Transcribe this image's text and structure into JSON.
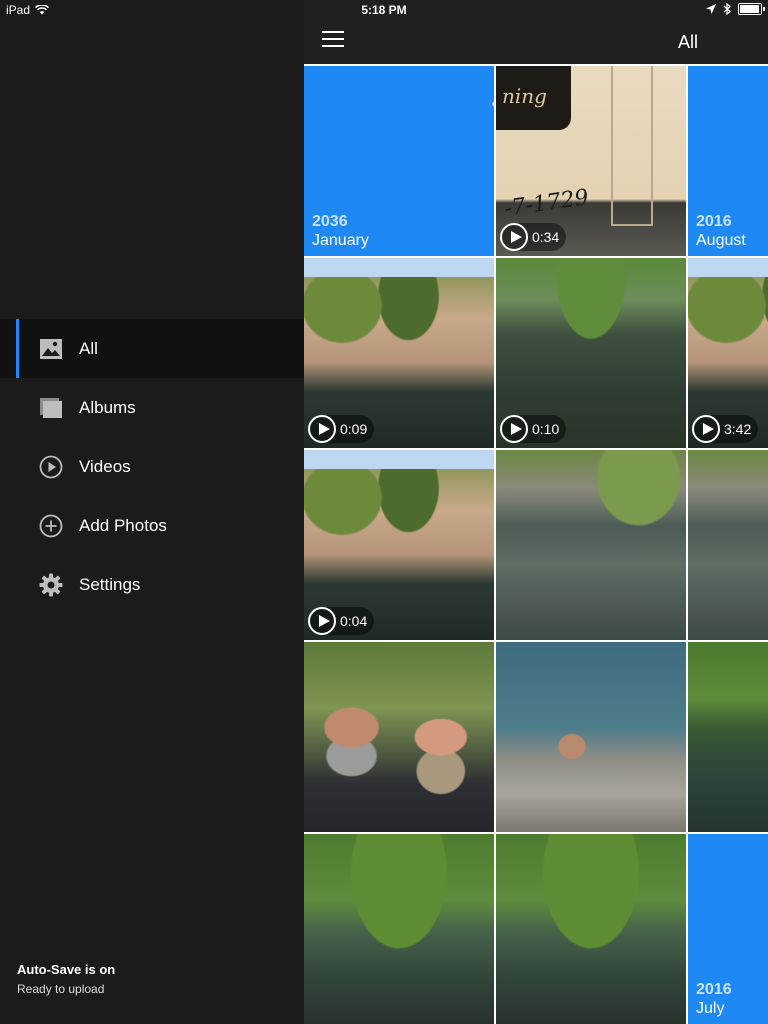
{
  "status_bar": {
    "device": "iPad",
    "time": "5:18 PM"
  },
  "sidebar": {
    "items": [
      {
        "label": "All",
        "icon": "image-icon",
        "active": true
      },
      {
        "label": "Albums",
        "icon": "albums-icon",
        "active": false
      },
      {
        "label": "Videos",
        "icon": "play-circle-icon",
        "active": false
      },
      {
        "label": "Add Photos",
        "icon": "plus-circle-icon",
        "active": false
      },
      {
        "label": "Settings",
        "icon": "gear-icon",
        "active": false
      }
    ],
    "autosave": {
      "title": "Auto-Save is on",
      "subtitle": "Ready to upload"
    }
  },
  "header": {
    "title": "All"
  },
  "grid": {
    "date_tiles": [
      {
        "year": "2036",
        "month": "January"
      },
      {
        "year": "2016",
        "month": "August"
      },
      {
        "year": "2016",
        "month": "July"
      }
    ],
    "videos": [
      {
        "duration": "0:34"
      },
      {
        "duration": "0:09"
      },
      {
        "duration": "0:10"
      },
      {
        "duration": "3:42"
      },
      {
        "duration": "0:04"
      }
    ]
  },
  "colors": {
    "accent": "#1e88f4",
    "sidebar_bg": "#1b1b1c",
    "topbar_bg": "#202022"
  }
}
